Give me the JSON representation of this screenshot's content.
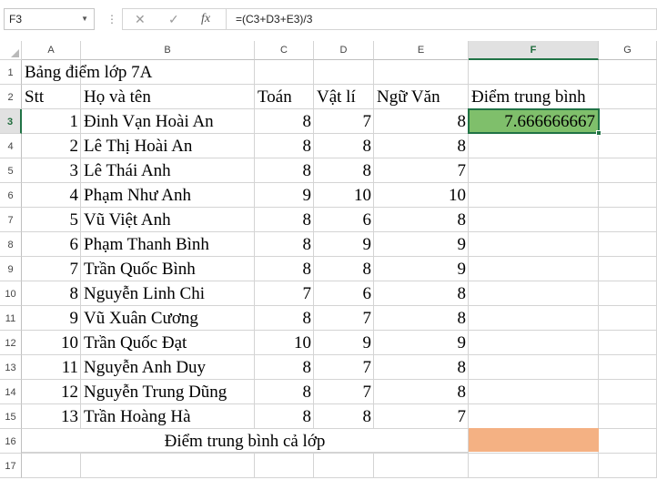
{
  "formula_bar": {
    "name_box": "F3",
    "cancel_icon": "✕",
    "enter_icon": "✓",
    "fx_label": "fx",
    "formula": "=(C3+D3+E3)/3"
  },
  "columns": [
    "A",
    "B",
    "C",
    "D",
    "E",
    "F",
    "G"
  ],
  "rows": [
    "1",
    "2",
    "3",
    "4",
    "5",
    "6",
    "7",
    "8",
    "9",
    "10",
    "11",
    "12",
    "13",
    "14",
    "15",
    "16",
    "17"
  ],
  "sheet": {
    "title": "Bảng điểm lớp 7A",
    "headers": {
      "stt": "Stt",
      "name": "Họ và tên",
      "math": "Toán",
      "physics": "Vật lí",
      "literature": "Ngữ Văn",
      "average": "Điểm trung bình"
    },
    "students": [
      {
        "stt": "1",
        "name": "Đinh Vạn Hoài An",
        "math": "8",
        "physics": "7",
        "literature": "8"
      },
      {
        "stt": "2",
        "name": "Lê Thị Hoài An",
        "math": "8",
        "physics": "8",
        "literature": "8"
      },
      {
        "stt": "3",
        "name": "Lê Thái Anh",
        "math": "8",
        "physics": "8",
        "literature": "7"
      },
      {
        "stt": "4",
        "name": "Phạm Như Anh",
        "math": "9",
        "physics": "10",
        "literature": "10"
      },
      {
        "stt": "5",
        "name": "Vũ Việt Anh",
        "math": "8",
        "physics": "6",
        "literature": "8"
      },
      {
        "stt": "6",
        "name": "Phạm Thanh Bình",
        "math": "8",
        "physics": "9",
        "literature": "9"
      },
      {
        "stt": "7",
        "name": "Trần Quốc Bình",
        "math": "8",
        "physics": "8",
        "literature": "9"
      },
      {
        "stt": "8",
        "name": "Nguyễn Linh Chi",
        "math": "7",
        "physics": "6",
        "literature": "8"
      },
      {
        "stt": "9",
        "name": "Vũ Xuân Cương",
        "math": "8",
        "physics": "7",
        "literature": "8"
      },
      {
        "stt": "10",
        "name": "Trần Quốc Đạt",
        "math": "10",
        "physics": "9",
        "literature": "9"
      },
      {
        "stt": "11",
        "name": "Nguyễn Anh Duy",
        "math": "8",
        "physics": "7",
        "literature": "8"
      },
      {
        "stt": "12",
        "name": "Nguyễn Trung Dũng",
        "math": "8",
        "physics": "7",
        "literature": "8"
      },
      {
        "stt": "13",
        "name": "Trần Hoàng Hà",
        "math": "8",
        "physics": "8",
        "literature": "7"
      }
    ],
    "active_cell_value": "7.666666667",
    "class_average_label": "Điểm trung bình cả lớp"
  },
  "colors": {
    "active_fill": "#7fbf6b",
    "selection_border": "#217346",
    "class_average_fill": "#f4b183"
  }
}
